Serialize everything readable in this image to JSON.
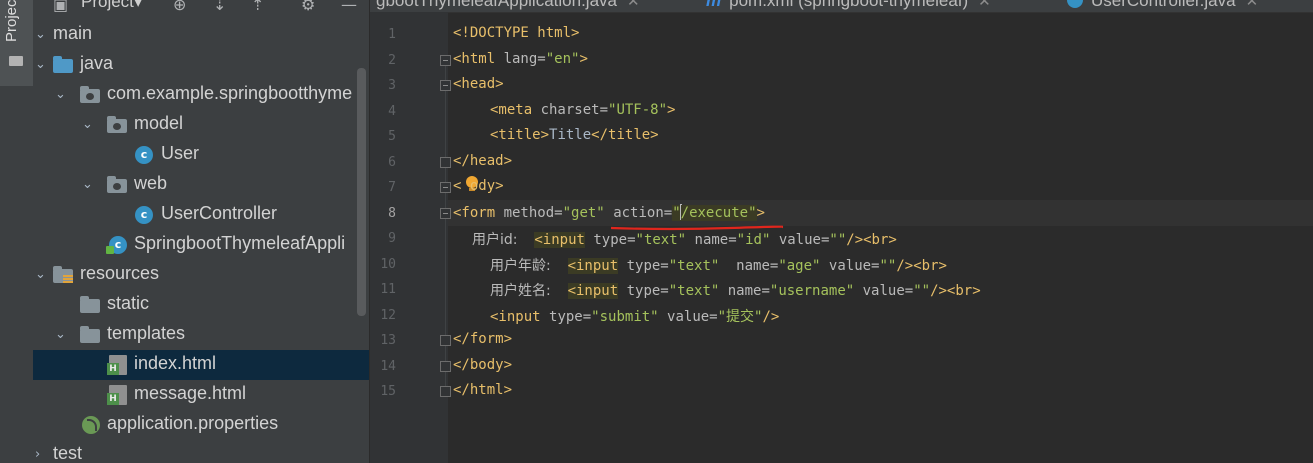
{
  "window": {
    "panel_title": "Project",
    "side_tab_label": "Project"
  },
  "tabs": [
    {
      "label": "gbootThymeleafApplication.java"
    },
    {
      "label": "pom.xml (springboot-thymeleaf)",
      "icon": "maven-icon"
    },
    {
      "label": "UserController.java",
      "icon": "class-icon"
    }
  ],
  "tree": [
    {
      "label": "main",
      "icon": "folder-icon",
      "expanded": true
    },
    {
      "label": "java",
      "icon": "source-folder-icon",
      "expanded": true
    },
    {
      "label": "com.example.springbootthyme",
      "icon": "package-icon",
      "expanded": true
    },
    {
      "label": "model",
      "icon": "package-icon",
      "expanded": true
    },
    {
      "label": "User",
      "icon": "class-icon"
    },
    {
      "label": "web",
      "icon": "package-icon",
      "expanded": true
    },
    {
      "label": "UserController",
      "icon": "class-icon"
    },
    {
      "label": "SpringbootThymeleafAppli",
      "icon": "spring-boot-class-icon"
    },
    {
      "label": "resources",
      "icon": "resources-folder-icon",
      "expanded": true
    },
    {
      "label": "static",
      "icon": "folder-icon"
    },
    {
      "label": "templates",
      "icon": "folder-icon",
      "expanded": true
    },
    {
      "label": "index.html",
      "icon": "html-file-icon",
      "selected": true
    },
    {
      "label": "message.html",
      "icon": "html-file-icon"
    },
    {
      "label": "application.properties",
      "icon": "properties-file-icon"
    },
    {
      "label": "test",
      "icon": "folder-icon"
    }
  ],
  "code": {
    "line_numbers": [
      "1",
      "2",
      "3",
      "4",
      "5",
      "6",
      "7",
      "8",
      "9",
      "10",
      "11",
      "12",
      "13",
      "14",
      "15"
    ],
    "lines": {
      "l1_a": "<!DOCTYPE html>",
      "l2_open": "<html ",
      "l2_attr": "lang=",
      "l2_val": "\"en\"",
      "l2_close": ">",
      "l3": "<head>",
      "l4_open": "<meta ",
      "l4_attr": "charset=",
      "l4_val": "\"UTF-8\"",
      "l4_close": ">",
      "l5_t1": "<title>",
      "l5_text": "Title",
      "l5_t2": "</title>",
      "l6": "</head>",
      "l7_a": "<",
      "l7_b": "b",
      "l7_c": "ody>",
      "l8_open": "<form ",
      "l8_attr1": "method=",
      "l8_val1": "\"get\"",
      "l8_attr2": "action=",
      "l8_q1": "\"",
      "l8_val2": "/execute",
      "l8_q2": "\"",
      "l8_close": ">",
      "l9_label": "用户id:",
      "l9_input": "<input",
      "l9_rest_attr1": " type=",
      "l9_rest_val1": "\"text\"",
      "l9_rest_attr2": " name=",
      "l9_rest_val2": "\"id\"",
      "l9_rest_attr3": " value=",
      "l9_rest_val3": "\"\"",
      "l9_end": "/><br>",
      "l10_label": "用户年龄:",
      "l10_input": "<input",
      "l10_attr1": " type=",
      "l10_val1": "\"text\"",
      "l10_attr2": "  name=",
      "l10_val2": "\"age\"",
      "l10_attr3": " value=",
      "l10_val3": "\"\"",
      "l10_end": "/><br>",
      "l11_label": "用户姓名:",
      "l11_input": "<input",
      "l11_attr1": " type=",
      "l11_val1": "\"text\"",
      "l11_attr2": " name=",
      "l11_val2": "\"username\"",
      "l11_attr3": " value=",
      "l11_val3": "\"\"",
      "l11_end": "/><br>",
      "l12_input": "<input ",
      "l12_attr1": "type=",
      "l12_val1": "\"submit\"",
      "l12_attr2": " value=",
      "l12_val2": "\"提交\"",
      "l12_end": "/>",
      "l13": "</form>",
      "l14": "</body>",
      "l15": "</html>"
    }
  },
  "colors": {
    "tag": "#e8bf6a",
    "attribute": "#bababa",
    "value": "#a5c25c",
    "annotation": "#e0261d",
    "selection": "#0d293e"
  }
}
